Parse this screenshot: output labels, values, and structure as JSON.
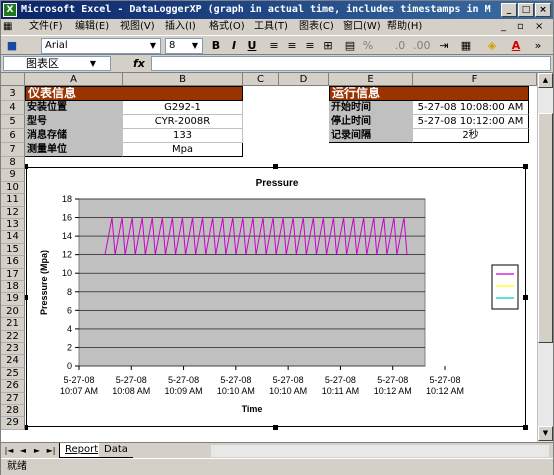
{
  "window": {
    "title": "Microsoft Excel - DataLoggerXP (graph in actual time, includes timestamps in MM-DD-YY fo..."
  },
  "menu": [
    "文件(F)",
    "编辑(E)",
    "视图(V)",
    "插入(I)",
    "格式(O)",
    "工具(T)",
    "图表(C)",
    "窗口(W)",
    "帮助(H)"
  ],
  "toolbar": {
    "font": "Arial",
    "size": "8",
    "bold": "B",
    "italic": "I",
    "underline": "U",
    "percent": "%"
  },
  "formula_bar": {
    "name_box": "图表区",
    "fx": "fx",
    "value": ""
  },
  "columns": [
    "A",
    "B",
    "C",
    "D",
    "E",
    "F"
  ],
  "rows": [
    "3",
    "4",
    "5",
    "6",
    "7",
    "8",
    "9",
    "10",
    "11",
    "12",
    "13",
    "14",
    "15",
    "16",
    "17",
    "18",
    "19",
    "20",
    "21",
    "22",
    "23",
    "24",
    "25",
    "26",
    "27",
    "28",
    "29"
  ],
  "instrument": {
    "header": "仪表信息",
    "rows": [
      {
        "label": "安装位置",
        "value": "G292-1"
      },
      {
        "label": "型号",
        "value": "CYR-2008R"
      },
      {
        "label": "消息存储",
        "value": "133"
      },
      {
        "label": "测量单位",
        "value": "Mpa"
      }
    ]
  },
  "run": {
    "header": "运行信息",
    "rows": [
      {
        "label": "开始时间",
        "value": "5-27-08 10:08:00 AM"
      },
      {
        "label": "停止时间",
        "value": "5-27-08 10:12:00 AM"
      },
      {
        "label": "记录间隔",
        "value": "2秒"
      }
    ]
  },
  "chart_data": {
    "type": "line",
    "title": "Pressure",
    "xlabel": "Time",
    "ylabel": "Pressure (Mpa)",
    "ylim": [
      0,
      18
    ],
    "yticks": [
      0,
      2,
      4,
      6,
      8,
      10,
      12,
      14,
      16,
      18
    ],
    "xtick_labels": [
      [
        "5-27-08",
        "10:07 AM"
      ],
      [
        "5-27-08",
        "10:08 AM"
      ],
      [
        "5-27-08",
        "10:09 AM"
      ],
      [
        "5-27-08",
        "10:10 AM"
      ],
      [
        "5-27-08",
        "10:10 AM"
      ],
      [
        "5-27-08",
        "10:11 AM"
      ],
      [
        "5-27-08",
        "10:12 AM"
      ],
      [
        "5-27-08",
        "10:12 AM"
      ]
    ],
    "grid": true,
    "plot_background": "#c0c0c0",
    "legend_placement": "right",
    "series": [
      {
        "color": "#cc00cc",
        "low": 12,
        "high": 16,
        "cycles": 30
      },
      {
        "color": "#ffff00"
      },
      {
        "color": "#00cccc"
      }
    ]
  },
  "sheets": [
    "Report",
    "Data"
  ],
  "active_sheet": "Report",
  "status": "就绪"
}
